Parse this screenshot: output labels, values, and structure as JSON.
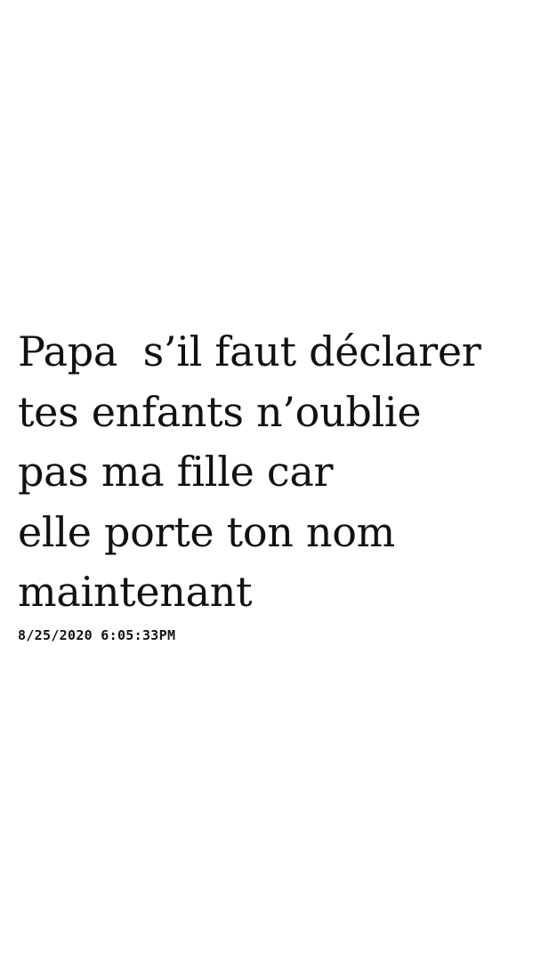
{
  "post": {
    "lines": [
      "Papa  s’il faut déclarer",
      "tes enfants n’oublie",
      "pas ma fille car",
      "elle porte ton nom",
      "maintenant"
    ],
    "timestamp": "8/25/2020 6:05:33PM"
  },
  "colors": {
    "background": "#ffffff",
    "text": "#111111"
  }
}
